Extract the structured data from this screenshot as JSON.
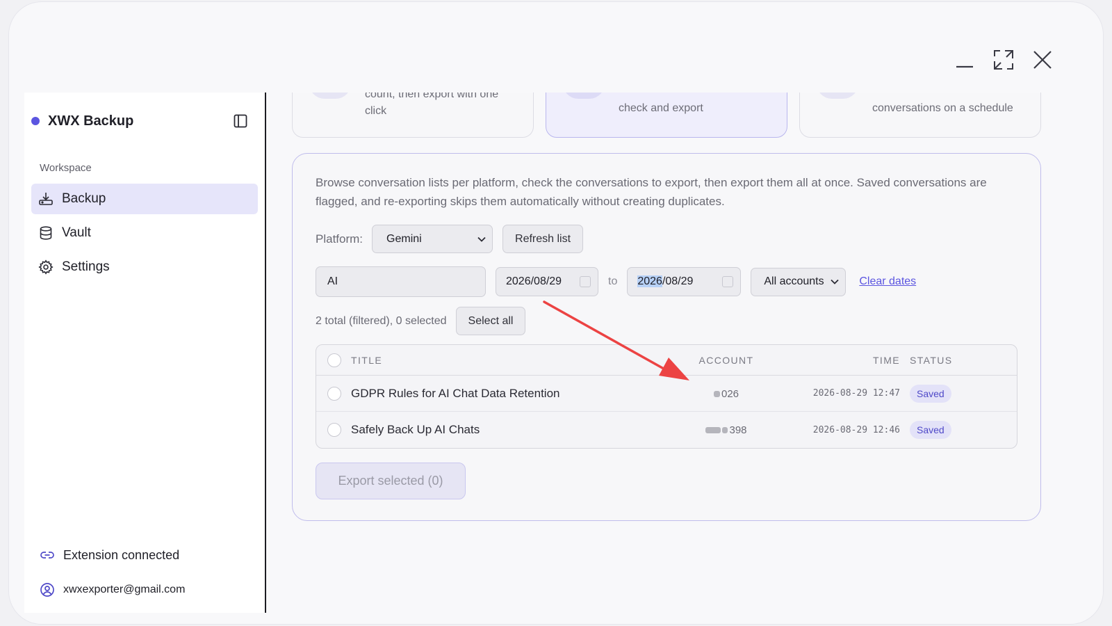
{
  "window": {
    "controls": [
      "minimize",
      "maximize",
      "close"
    ]
  },
  "sidebar": {
    "brand": "XWX Backup",
    "section_label": "Workspace",
    "items": [
      {
        "label": "Backup",
        "icon": "download-tray-icon",
        "active": true
      },
      {
        "label": "Vault",
        "icon": "database-icon",
        "active": false
      },
      {
        "label": "Settings",
        "icon": "gear-icon",
        "active": false
      }
    ],
    "extension_status": "Extension connected",
    "account_email": "xwxexporter@gmail.com"
  },
  "mode_cards": [
    {
      "desc_line1": "count, then export with one",
      "desc_line2": "click",
      "selected": false
    },
    {
      "desc_line1": "check and export",
      "selected": true
    },
    {
      "desc_line1": "conversations on a schedule",
      "selected": false
    }
  ],
  "panel": {
    "intro": "Browse conversation lists per platform, check the conversations to export, then export them all at once. Saved conversations are flagged, and re-exporting skips them automatically without creating duplicates.",
    "platform_label": "Platform:",
    "platform_value": "Gemini",
    "refresh_label": "Refresh list",
    "search_value": "AI",
    "date_from": "2026/08/29",
    "to_label": "to",
    "date_to_year": "2026",
    "date_to_rest": "/08/29",
    "accounts_value": "All accounts",
    "clear_dates_label": "Clear dates",
    "count_text": "2 total (filtered), 0 selected",
    "select_all_label": "Select all",
    "table": {
      "headers": {
        "title": "TITLE",
        "account": "ACCOUNT",
        "time": "TIME",
        "status": "STATUS"
      },
      "rows": [
        {
          "title": "GDPR Rules for AI Chat Data Retention",
          "account_suffix": "026",
          "time": "2026-08-29 12:47",
          "status": "Saved"
        },
        {
          "title": "Safely Back Up AI Chats",
          "account_suffix": "398",
          "time": "2026-08-29 12:46",
          "status": "Saved"
        }
      ]
    },
    "export_label": "Export selected (0)"
  },
  "colors": {
    "accent": "#5b55e0",
    "annotation_arrow": "#ec4343"
  }
}
